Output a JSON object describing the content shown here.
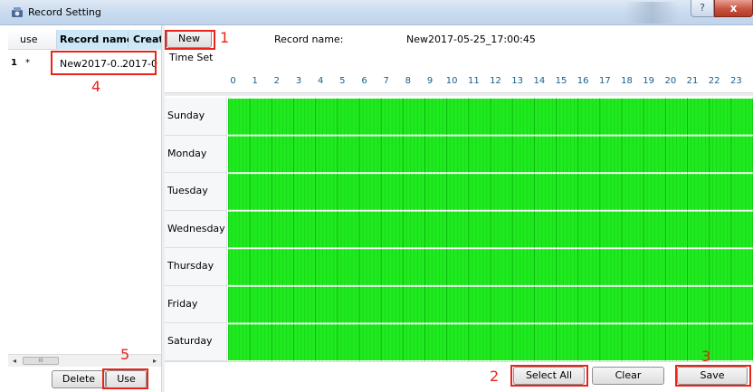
{
  "window": {
    "title": "Record Setting",
    "help_label": "?",
    "close_label": "x"
  },
  "record_list": {
    "columns": [
      "use",
      "Record name",
      "Creat"
    ],
    "rows": [
      {
        "index": "1",
        "use": "*",
        "name": "New2017-0...",
        "created": "2017-0"
      }
    ],
    "scroll_thumb": "III",
    "scroll_left": "◂",
    "scroll_right": "▸",
    "delete_label": "Delete",
    "use_label": "Use"
  },
  "editor": {
    "new_label": "New",
    "record_name_label": "Record name:",
    "record_name_value": "New2017-05-25_17:00:45",
    "time_set_label": "Time Set",
    "hours": [
      "0",
      "1",
      "2",
      "3",
      "4",
      "5",
      "6",
      "7",
      "8",
      "9",
      "10",
      "11",
      "12",
      "13",
      "14",
      "15",
      "16",
      "17",
      "18",
      "19",
      "20",
      "21",
      "22",
      "23"
    ],
    "days": [
      "Sunday",
      "Monday",
      "Tuesday",
      "Wednesday",
      "Thursday",
      "Friday",
      "Saturday"
    ],
    "schedule_fill_fraction": 1.0,
    "select_all_label": "Select All",
    "clear_label": "Clear",
    "save_label": "Save"
  },
  "annotations": [
    "1",
    "2",
    "3",
    "4",
    "5"
  ],
  "colors": {
    "schedule_green": "#1fea1f",
    "annotation_red": "#e8241b",
    "header_highlight": "#cce8f7",
    "hour_label": "#14608f"
  }
}
